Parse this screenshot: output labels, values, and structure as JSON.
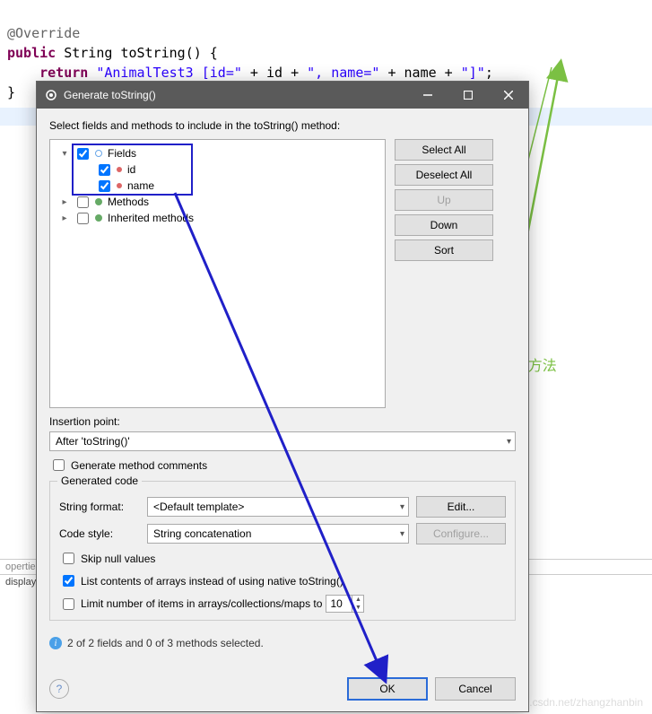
{
  "code": {
    "l1_anno": "@Override",
    "l2_kw1": "public",
    "l2_type": "String",
    "l2_name": "toString",
    "l2_paren": "() {",
    "l3_kw": "return",
    "l3_s1": "\"AnimalTest3 [id=\"",
    "l3_p1": " + ",
    "l3_v1": "id",
    "l3_p2": " + ",
    "l3_s2": "\", name=\"",
    "l3_p3": " + ",
    "l3_v2": "name",
    "l3_p4": " + ",
    "l3_s3": "\"]\"",
    "l3_end": ";",
    "l4": "}"
  },
  "annotation_text": "点击ok后自动重写了toString()方法",
  "watermark": "https://blog.csdn.net/zhangzhanbin",
  "bottom_panel": {
    "tab": "operties",
    "row": "display"
  },
  "dialog": {
    "title": "Generate toString()",
    "prompt": "Select fields and methods to include in the toString() method:",
    "tree": {
      "fields": {
        "label": "Fields",
        "checked": true,
        "expanded": true
      },
      "id": {
        "label": "id",
        "checked": true
      },
      "name": {
        "label": "name",
        "checked": true
      },
      "methods": {
        "label": "Methods",
        "checked": false,
        "expanded": false
      },
      "inherited": {
        "label": "Inherited methods",
        "checked": false,
        "expanded": false
      }
    },
    "buttons": {
      "select_all": "Select All",
      "deselect_all": "Deselect All",
      "up": "Up",
      "down": "Down",
      "sort": "Sort"
    },
    "insertion_label": "Insertion point:",
    "insertion_value": "After 'toString()'",
    "gen_comments": {
      "label": "Generate method comments",
      "checked": false
    },
    "group": {
      "legend": "Generated code",
      "string_format_label": "String format:",
      "string_format_value": "<Default template>",
      "edit": "Edit...",
      "code_style_label": "Code style:",
      "code_style_value": "String concatenation",
      "configure": "Configure...",
      "skip_null": {
        "label": "Skip null values",
        "checked": false
      },
      "list_arrays": {
        "label": "List contents of arrays instead of using native toString()",
        "checked": true
      },
      "limit": {
        "label": "Limit number of items in arrays/collections/maps to",
        "checked": false,
        "value": "10"
      }
    },
    "status": "2 of 2 fields and 0 of 3 methods selected.",
    "ok": "OK",
    "cancel": "Cancel"
  }
}
